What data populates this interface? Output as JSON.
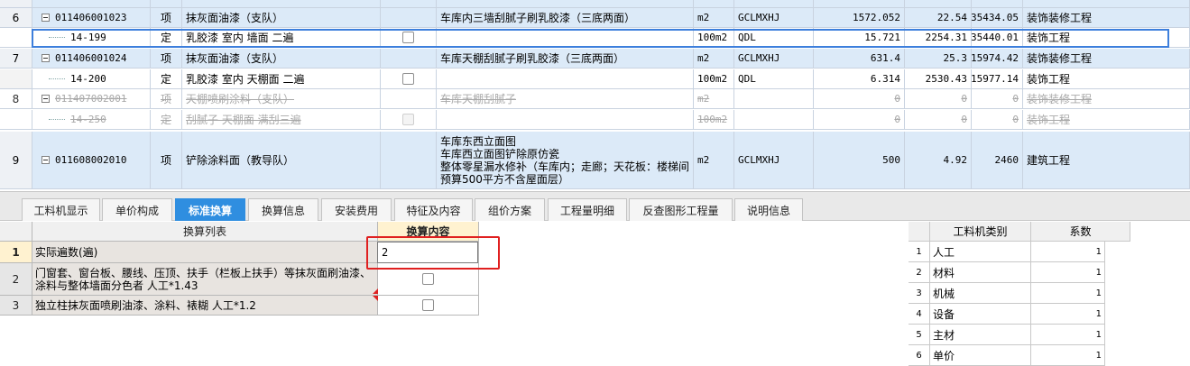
{
  "top_rows": [
    {
      "idx": "6",
      "code": "011406001023",
      "kind": "项",
      "name": "抹灰面油漆（支队）",
      "features": [
        "车库内三墙刮腻子刷乳胶漆（三底两面）"
      ],
      "unit": "m2",
      "qty_expr": "GCLMXHJ",
      "qty": "1572.052",
      "price": "22.54",
      "total": "35434.05",
      "major": "装饰装修工程",
      "style": "blue",
      "level": 1,
      "checkbox": false
    },
    {
      "idx": "",
      "code": "14-199",
      "kind": "定",
      "name": "乳胶漆 室内 墙面 二遍",
      "features": [],
      "unit": "100m2",
      "qty_expr": "QDL",
      "qty": "15.721",
      "price": "2254.31",
      "total": "35440.01",
      "major": "装饰工程",
      "style": "selected",
      "level": 2,
      "checkbox": true
    },
    {
      "idx": "7",
      "code": "011406001024",
      "kind": "项",
      "name": "抹灰面油漆（支队）",
      "features": [
        "车库天棚刮腻子刷乳胶漆（三底两面）"
      ],
      "unit": "m2",
      "qty_expr": "GCLMXHJ",
      "qty": "631.4",
      "price": "25.3",
      "total": "15974.42",
      "major": "装饰装修工程",
      "style": "blue",
      "level": 1,
      "checkbox": false
    },
    {
      "idx": "",
      "code": "14-200",
      "kind": "定",
      "name": "乳胶漆 室内 天棚面 二遍",
      "features": [],
      "unit": "100m2",
      "qty_expr": "QDL",
      "qty": "6.314",
      "price": "2530.43",
      "total": "15977.14",
      "major": "装饰工程",
      "style": "white",
      "level": 2,
      "checkbox": true
    },
    {
      "idx": "8",
      "code": "011407002001",
      "kind": "项",
      "name": "天棚喷刷涂料（支队）",
      "features": [
        "车库天棚刮腻子"
      ],
      "unit": "m2",
      "qty_expr": "",
      "qty": "0",
      "price": "0",
      "total": "0",
      "major": "装饰装修工程",
      "style": "deleted",
      "level": 1,
      "checkbox": false
    },
    {
      "idx": "",
      "code": "14-250",
      "kind": "定",
      "name": "刮腻子 天棚面 满刮三遍",
      "features": [],
      "unit": "100m2",
      "qty_expr": "",
      "qty": "0",
      "price": "0",
      "total": "0",
      "major": "装饰工程",
      "style": "deleted",
      "level": 2,
      "checkbox": true
    },
    {
      "idx": "9",
      "code": "011608002010",
      "kind": "项",
      "name": "铲除涂料面（教导队）",
      "features": [
        "车库东西立面图",
        "车库西立面图铲除原仿瓷",
        "整体零星漏水修补（车库内；走廊；天花板：楼梯间",
        "预算500平方不含屋面层）"
      ],
      "unit": "m2",
      "qty_expr": "GCLMXHJ",
      "qty": "500",
      "price": "4.92",
      "total": "2460",
      "major": "建筑工程",
      "style": "blue",
      "level": 1,
      "checkbox": false
    }
  ],
  "tabs": [
    {
      "label": "工料机显示",
      "active": false
    },
    {
      "label": "单价构成",
      "active": false
    },
    {
      "label": "标准换算",
      "active": true
    },
    {
      "label": "换算信息",
      "active": false
    },
    {
      "label": "安装费用",
      "active": false
    },
    {
      "label": "特征及内容",
      "active": false
    },
    {
      "label": "组价方案",
      "active": false
    },
    {
      "label": "工程量明细",
      "active": false
    },
    {
      "label": "反查图形工程量",
      "active": false
    },
    {
      "label": "说明信息",
      "active": false
    }
  ],
  "conversion": {
    "header_list": "换算列表",
    "header_content": "换算内容",
    "rows": [
      {
        "idx": "1",
        "text": "实际遍数(遍)",
        "value": "2",
        "control": "input"
      },
      {
        "idx": "2",
        "text": "门窗套、窗台板、腰线、压顶、扶手（栏板上扶手）等抹灰面刷油漆、涂料与整体墙面分色者 人工*1.43",
        "value": "",
        "control": "checkbox"
      },
      {
        "idx": "3",
        "text": "独立柱抹灰面喷刷油漆、涂料、裱糊 人工*1.2",
        "value": "",
        "control": "checkbox"
      }
    ]
  },
  "coefficients": {
    "header_type": "工料机类别",
    "header_coef": "系数",
    "rows": [
      {
        "idx": "1",
        "type": "人工",
        "coef": "1"
      },
      {
        "idx": "2",
        "type": "材料",
        "coef": "1"
      },
      {
        "idx": "3",
        "type": "机械",
        "coef": "1"
      },
      {
        "idx": "4",
        "type": "设备",
        "coef": "1"
      },
      {
        "idx": "5",
        "type": "主材",
        "coef": "1"
      },
      {
        "idx": "6",
        "type": "单价",
        "coef": "1"
      }
    ]
  },
  "colors": {
    "accent": "#2f8ee0",
    "highlight_border": "#e02020",
    "row_blue": "#dceaf8",
    "selection": "#3d7fdc"
  }
}
